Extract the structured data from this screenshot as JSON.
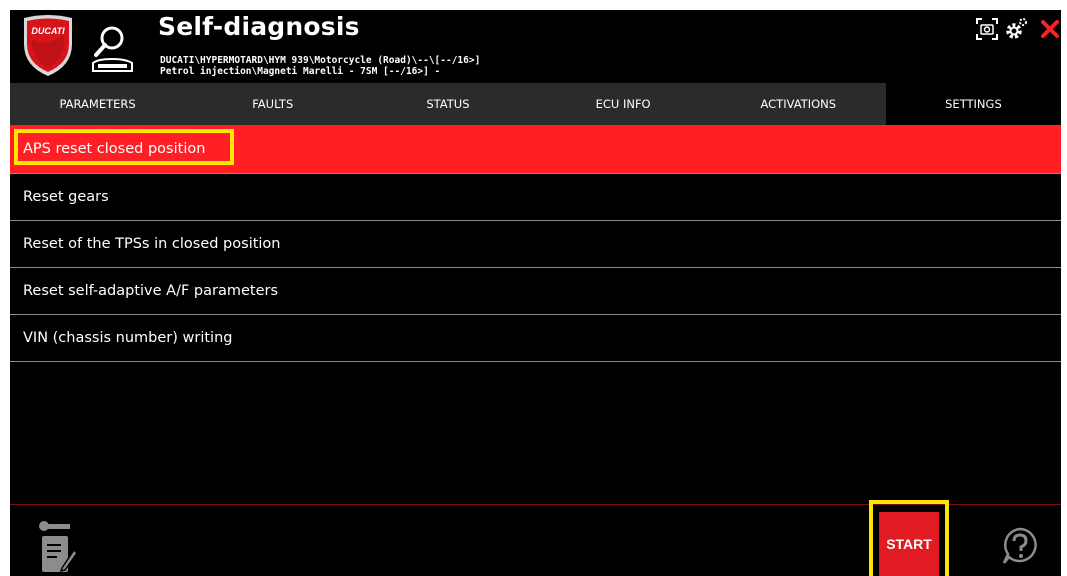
{
  "brand": {
    "logo_text": "DUCATI"
  },
  "header": {
    "title": "Self-diagnosis",
    "subtitle_line1": "DUCATI\\HYPERMOTARD\\HYM 939\\Motorcycle (Road)\\--\\[--/16>]",
    "subtitle_line2": "Petrol injection\\Magneti Marelli - 7SM [--/16>] -"
  },
  "tabs": [
    {
      "label": "PARAMETERS",
      "active": false
    },
    {
      "label": "FAULTS",
      "active": false
    },
    {
      "label": "STATUS",
      "active": false
    },
    {
      "label": "ECU INFO",
      "active": false
    },
    {
      "label": "ACTIVATIONS",
      "active": false
    },
    {
      "label": "SETTINGS",
      "active": true
    }
  ],
  "procedures": [
    {
      "label": "APS reset closed position",
      "selected": true
    },
    {
      "label": "Reset gears",
      "selected": false
    },
    {
      "label": "Reset of the TPSs in closed position",
      "selected": false
    },
    {
      "label": "Reset self-adaptive A/F parameters",
      "selected": false
    },
    {
      "label": "VIN (chassis number) writing",
      "selected": false
    }
  ],
  "footer": {
    "start_label": "START"
  },
  "colors": {
    "accent_red": "#ff1f25",
    "highlight": "#ffe600",
    "tab_bar": "#2b2b2b"
  }
}
